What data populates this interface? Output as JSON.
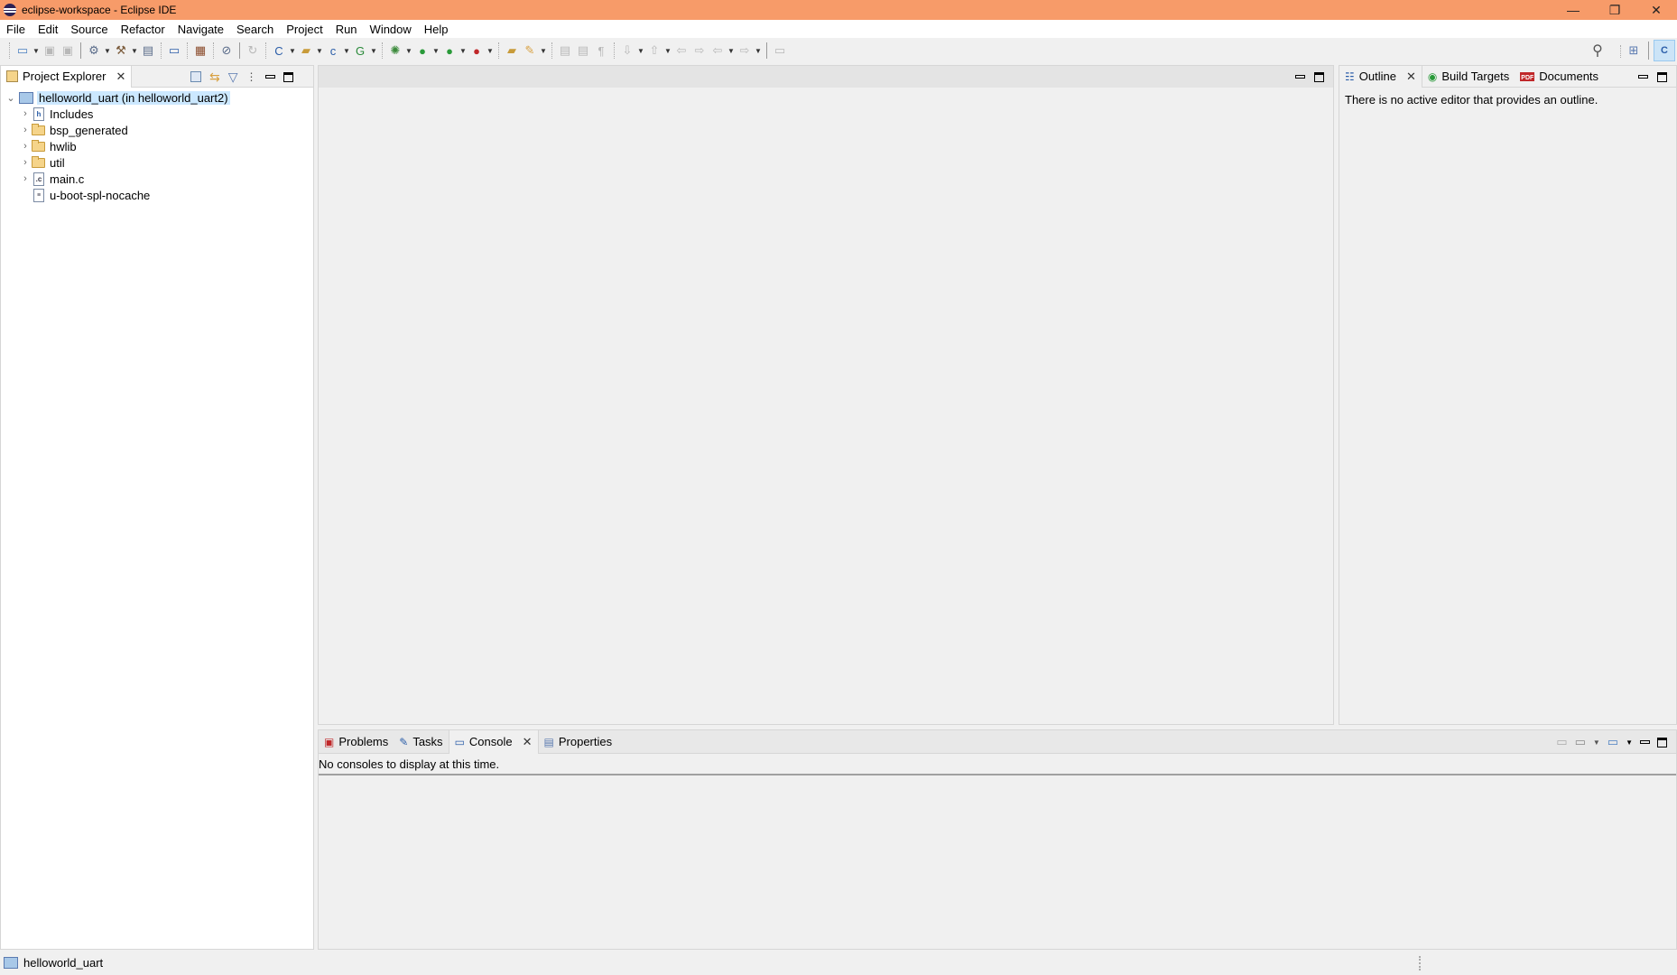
{
  "window": {
    "title": "eclipse-workspace - Eclipse IDE",
    "controls": {
      "minimize": "—",
      "restore": "❐",
      "close": "✕"
    }
  },
  "menubar": {
    "items": [
      "File",
      "Edit",
      "Source",
      "Refactor",
      "Navigate",
      "Search",
      "Project",
      "Run",
      "Window",
      "Help"
    ]
  },
  "toolbar": {
    "left_icons": [
      "new-icon",
      "save-icon",
      "save-all-icon",
      "build-config-icon",
      "build-hammer-icon",
      "binary-icon",
      "terminal-icon",
      "plugin-icon",
      "skip-breakpoints-icon",
      "step-return-icon",
      "new-c-project-icon",
      "new-source-folder-icon",
      "new-class-icon",
      "new-generic-icon",
      "debug-icon",
      "run-icon",
      "coverage-icon",
      "external-tools-icon",
      "open-type-icon",
      "search-pen-icon",
      "toggle-word-wrap-icon",
      "block-selection-icon",
      "show-whitespace-icon",
      "next-annotation-icon",
      "prev-annotation-icon",
      "last-edit-icon",
      "next-edit-icon",
      "back-icon",
      "forward-icon",
      "pin-editor-icon"
    ],
    "right_icons": [
      "search-icon",
      "open-perspective-icon",
      "c-cpp-perspective-icon"
    ]
  },
  "project_explorer": {
    "tab_label": "Project Explorer",
    "tree": {
      "root": "helloworld_uart (in helloworld_uart2)",
      "children": [
        {
          "label": "Includes",
          "type": "includes",
          "expandable": true
        },
        {
          "label": "bsp_generated",
          "type": "folder",
          "expandable": true
        },
        {
          "label": "hwlib",
          "type": "folder",
          "expandable": true
        },
        {
          "label": "util",
          "type": "folder",
          "expandable": true
        },
        {
          "label": "main.c",
          "type": "c-file",
          "expandable": true
        },
        {
          "label": "u-boot-spl-nocache",
          "type": "file",
          "expandable": false
        }
      ]
    }
  },
  "outline_panel": {
    "tabs": [
      {
        "label": "Outline",
        "active": true,
        "closable": true
      },
      {
        "label": "Build Targets",
        "active": false
      },
      {
        "label": "Documents",
        "active": false
      }
    ],
    "message": "There is no active editor that provides an outline."
  },
  "bottom_panel": {
    "tabs": [
      {
        "label": "Problems",
        "active": false
      },
      {
        "label": "Tasks",
        "active": false
      },
      {
        "label": "Console",
        "active": true,
        "closable": true
      },
      {
        "label": "Properties",
        "active": false
      }
    ],
    "message": "No consoles to display at this time."
  },
  "statusbar": {
    "label": "helloworld_uart"
  }
}
